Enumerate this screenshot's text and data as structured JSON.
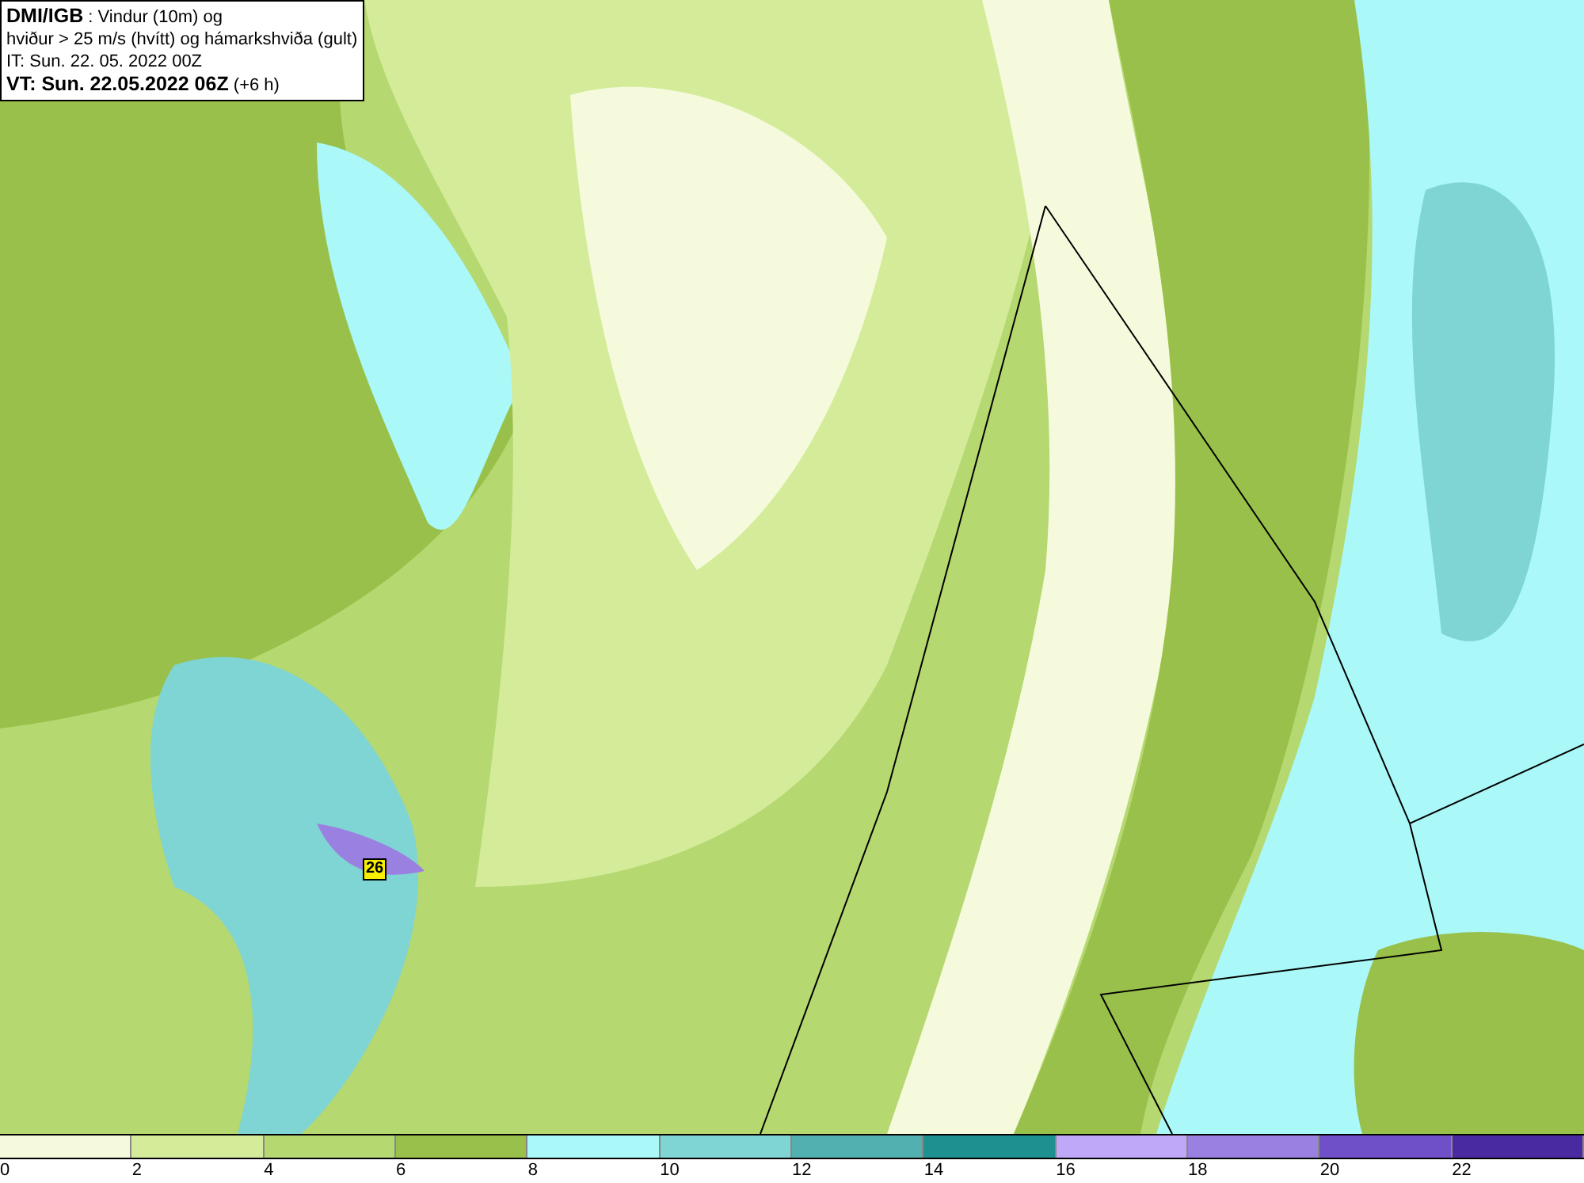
{
  "title_box": {
    "lines": [
      "**DMI/IGB** : Vindur (10m) og",
      "hviður > 25 m/s (hvítt) og hámarkshviða (gult)",
      "IT: Sun. 22. 05. 2022 00Z",
      "**VT: Sun. 22.05.2022 06Z** (+6 h)"
    ]
  },
  "map": {
    "max_gust_label": "26"
  },
  "legend": {
    "bins": [
      {
        "label": "0",
        "color": "#f5fadc"
      },
      {
        "label": "2",
        "color": "#d4ec9a"
      },
      {
        "label": "4",
        "color": "#b5d870"
      },
      {
        "label": "6",
        "color": "#99c04a"
      },
      {
        "label": "8",
        "color": "#aaf8f8"
      },
      {
        "label": "10",
        "color": "#7fd4d4"
      },
      {
        "label": "12",
        "color": "#52b0b0"
      },
      {
        "label": "14",
        "color": "#1e9090"
      },
      {
        "label": "16",
        "color": "#c0a8f8"
      },
      {
        "label": "18",
        "color": "#9a80e0"
      },
      {
        "label": "20",
        "color": "#7050c8"
      },
      {
        "label": "22",
        "color": "#4a2aa0"
      }
    ]
  }
}
